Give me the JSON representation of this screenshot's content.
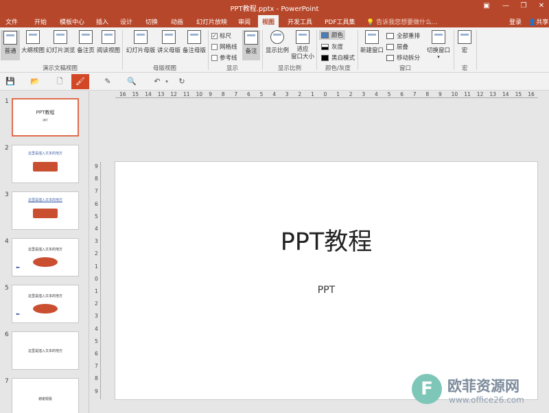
{
  "window": {
    "title": "PPT教程.pptx - PowerPoint"
  },
  "tabs": [
    "文件",
    "开始",
    "模板中心",
    "插入",
    "设计",
    "切换",
    "动画",
    "幻灯片放映",
    "审阅",
    "视图",
    "开发工具",
    "PDF工具集"
  ],
  "tell_me": "告诉我您想要做什么...",
  "login": "登录",
  "share": "共享",
  "ribbon": {
    "presentation_views": {
      "label": "演示文稿视图",
      "buttons": [
        "普通",
        "大纲视图",
        "幻灯片浏览",
        "备注页",
        "阅读视图"
      ]
    },
    "master_views": {
      "label": "母版视图",
      "buttons": [
        "幻灯片母版",
        "讲义母版",
        "备注母版"
      ]
    },
    "show": {
      "label": "显示",
      "checks": [
        {
          "label": "标尺",
          "checked": true
        },
        {
          "label": "网格线",
          "checked": false
        },
        {
          "label": "参考线",
          "checked": false
        }
      ],
      "notes": "备注"
    },
    "zoom": {
      "label": "显示比例",
      "zoom": "显示比例",
      "fit_line1": "适应",
      "fit_line2": "窗口大小"
    },
    "color": {
      "label": "颜色/灰度",
      "items": [
        "颜色",
        "灰度",
        "黑白模式"
      ]
    },
    "window": {
      "label": "窗口",
      "new_window": "新建窗口",
      "items": [
        "全部重排",
        "层叠",
        "移动拆分"
      ]
    },
    "switch_window": "切换窗口",
    "macros": {
      "label": "宏",
      "button": "宏"
    }
  },
  "ruler_h": [
    "16",
    "15",
    "14",
    "13",
    "12",
    "11",
    "10",
    "9",
    "8",
    "7",
    "6",
    "5",
    "4",
    "3",
    "2",
    "1",
    "0",
    "1",
    "2",
    "3",
    "4",
    "5",
    "6",
    "7",
    "8",
    "9",
    "10",
    "11",
    "12",
    "13",
    "14",
    "15",
    "16"
  ],
  "ruler_v": [
    "9",
    "8",
    "7",
    "6",
    "5",
    "4",
    "3",
    "2",
    "1",
    "0",
    "1",
    "2",
    "3",
    "4",
    "5",
    "6",
    "7",
    "8",
    "9"
  ],
  "slides": [
    {
      "num": "1",
      "title": "PPT教程",
      "sub": "PPT"
    },
    {
      "num": "2",
      "title": "这里是插入文本的地方"
    },
    {
      "num": "3",
      "title": "这里是插入文本的地方"
    },
    {
      "num": "4",
      "title": "这里是插入文本的地方"
    },
    {
      "num": "5",
      "title": "这里是插入文本的地方"
    },
    {
      "num": "6",
      "title": "这里是插入文本的地方"
    },
    {
      "num": "7",
      "title": "谢谢观看"
    }
  ],
  "main_slide": {
    "title": "PPT教程",
    "subtitle": "PPT"
  },
  "watermark": {
    "badge": "F",
    "text": "欧菲资源网",
    "url": "www.office26.com"
  }
}
